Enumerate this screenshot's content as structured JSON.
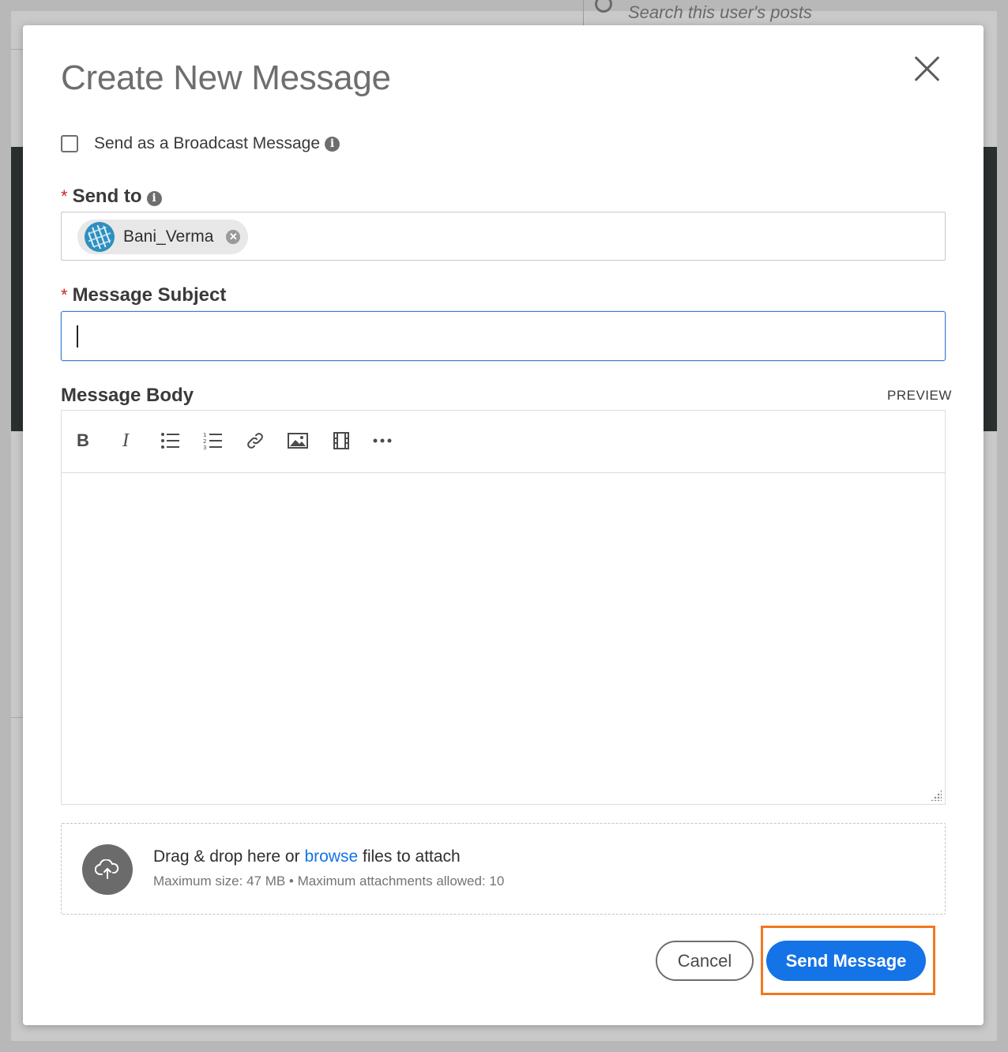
{
  "background": {
    "search_placeholder": "Search this user's posts"
  },
  "modal": {
    "title": "Create New Message",
    "broadcast_label": "Send as a Broadcast Message",
    "broadcast_checked": false,
    "send_to": {
      "label": "Send to",
      "required_marker": "*",
      "recipients": [
        {
          "name": "Bani_Verma"
        }
      ]
    },
    "subject": {
      "label": "Message Subject",
      "required_marker": "*",
      "value": ""
    },
    "body": {
      "label": "Message Body",
      "preview_label": "PREVIEW",
      "value": "",
      "toolbar": [
        "bold-icon",
        "italic-icon",
        "bullet-list-icon",
        "numbered-list-icon",
        "link-icon",
        "image-icon",
        "video-icon",
        "more-icon"
      ]
    },
    "attach": {
      "prefix": "Drag & drop here or",
      "browse": "browse",
      "suffix": "files to attach",
      "limits": "Maximum size: 47 MB • Maximum attachments allowed: 10"
    },
    "buttons": {
      "cancel": "Cancel",
      "send": "Send Message"
    }
  },
  "colors": {
    "primary": "#1473e6",
    "highlight": "#f07820",
    "required": "#c9252c"
  }
}
